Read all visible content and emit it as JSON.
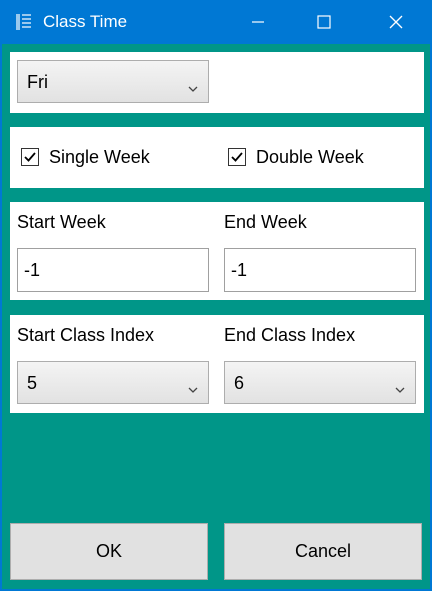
{
  "window": {
    "title": "Class Time",
    "accent_color": "#0078d4",
    "background_color": "#009688",
    "icons": {
      "app": "list-icon",
      "minimize": "minimize-icon",
      "maximize": "maximize-icon",
      "close": "close-icon"
    }
  },
  "day_select": {
    "value": "Fri"
  },
  "week_type": {
    "single": {
      "label": "Single Week",
      "checked": true
    },
    "double": {
      "label": "Double Week",
      "checked": true
    }
  },
  "week_range": {
    "start_label": "Start Week",
    "start_value": "-1",
    "end_label": "End Week",
    "end_value": "-1"
  },
  "class_range": {
    "start_label": "Start Class Index",
    "start_value": "5",
    "end_label": "End Class Index",
    "end_value": "6"
  },
  "actions": {
    "ok_label": "OK",
    "cancel_label": "Cancel"
  }
}
